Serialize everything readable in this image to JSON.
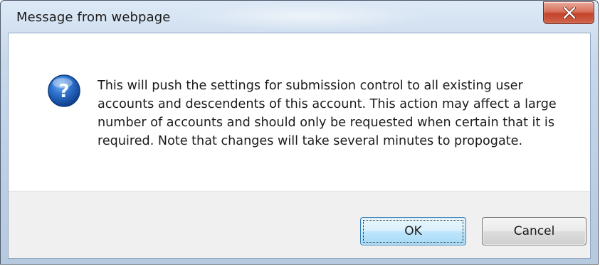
{
  "dialog": {
    "title": "Message from webpage",
    "message": "This will push the settings for submission control to all existing user accounts and descendents of this account. This action may affect a large number of accounts and should only be requested when certain that it is required. Note that changes will take several minutes to propogate.",
    "icon": "question-icon",
    "close_icon": "close-icon"
  },
  "buttons": {
    "ok_label": "OK",
    "cancel_label": "Cancel"
  },
  "colors": {
    "titlebar": "#c8d9ec",
    "close_button": "#c4432a",
    "icon_blue": "#1c5fb8",
    "footer": "#f0f0f0"
  }
}
